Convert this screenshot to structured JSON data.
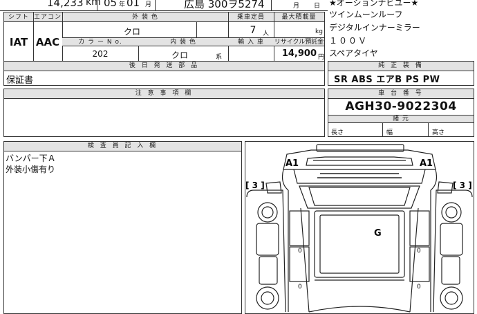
{
  "top": {
    "mileage": "14,233",
    "mileage_unit": "km",
    "year": "05",
    "year_unit": "年",
    "month": "01",
    "month_unit": "月",
    "plate": "広島 300ヲ5274",
    "date_month_unit": "月",
    "date_day_unit": "日"
  },
  "labels": {
    "shift": "シフト",
    "aircon": "エアコン",
    "exterior_color": "外 装 色",
    "capacity": "乗車定員",
    "max_load": "最大積載量",
    "color_no": "カ ラ ー N o.",
    "interior_color": "内 装 色",
    "import": "輸 入 車",
    "recycle": "リサイクル預託金",
    "delivery_parts": "後 日 発 送 部 品",
    "genuine_equipment": "純 正 装 備",
    "notes": "注 意 事 項 欄",
    "chassis_no": "車 台 番 号",
    "dimensions": "諸 元",
    "length": "長さ",
    "width": "幅",
    "height": "高さ",
    "inspector": "検 査 員 記 入 欄"
  },
  "values": {
    "shift": "IAT",
    "aircon": "AAC",
    "exterior_color": "クロ",
    "capacity": "7",
    "capacity_unit": "人",
    "max_load_unit": "kg",
    "color_no": "202",
    "interior_color": "クロ",
    "interior_suffix": "系",
    "recycle": "14,900",
    "recycle_unit": "円",
    "delivery_parts": "保証書",
    "chassis_no": "AGH30-9022304"
  },
  "options": [
    "★オーションナビユー★",
    "ツインムーンルーフ",
    "デジタルインナーミラー",
    "１００Ｖ",
    "スペアタイヤ"
  ],
  "equipment": "SR ABS エアB PS PW",
  "inspector_notes": [
    "バンパー下Ａ",
    "外装小傷有り"
  ],
  "diagram_marks": {
    "front_left": "A1",
    "front_right": "A1",
    "left_side": "[ 3 ]",
    "right_side": "[ 3 ]",
    "roof": "G",
    "zero_1": "0",
    "zero_2": "0",
    "zero_3": "0",
    "zero_4": "0"
  }
}
